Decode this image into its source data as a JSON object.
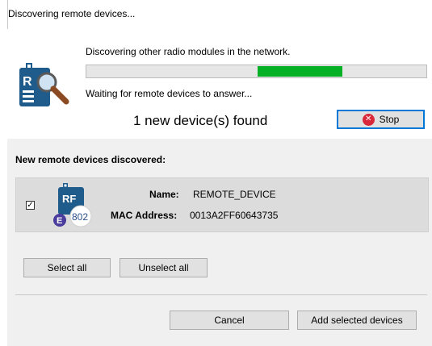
{
  "dialog": {
    "title": "Discovering remote devices..."
  },
  "status": {
    "message": "Discovering other radio modules in the network.",
    "progress_start": 0.5,
    "progress_end": 0.75,
    "waiting_message": "Waiting for remote devices to answer...",
    "found_text": "1 new device(s) found",
    "stop_label": "Stop"
  },
  "section": {
    "heading": "New remote devices discovered:"
  },
  "device": {
    "checked": true,
    "icon_text": "RF",
    "badge_letter": "E",
    "badge_number": "802",
    "name_label": "Name:",
    "name_value": "REMOTE_DEVICE",
    "mac_label": "MAC Address:",
    "mac_value": "0013A2FF60643735"
  },
  "actions": {
    "select_all": "Select all",
    "unselect_all": "Unselect all",
    "cancel": "Cancel",
    "add_selected": "Add selected devices"
  },
  "colors": {
    "progress_fill": "#06b025",
    "stop_red": "#d9283a",
    "accent_blue": "#0078d7"
  }
}
